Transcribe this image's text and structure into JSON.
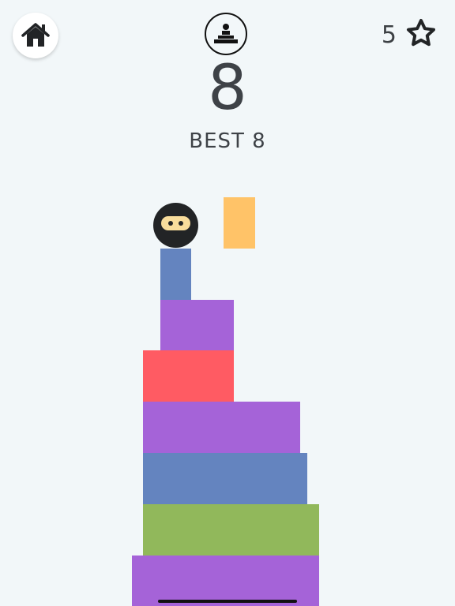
{
  "hud": {
    "home_icon": "house-icon",
    "mode_icon": "stacked-tower-icon",
    "star_icon": "star-outline-icon",
    "star_count": "5"
  },
  "score": {
    "current": "8",
    "best_label": "BEST 8"
  },
  "player": {
    "name": "ninja",
    "mask_color": "#f8dd9c",
    "body_color": "#222426"
  },
  "colors": {
    "background": "#f2f7f9",
    "purple": "#a563d8",
    "red": "#ff5b63",
    "blue": "#6484bf",
    "green": "#91b85b",
    "orange": "#ffc368",
    "text": "#3e4247"
  }
}
